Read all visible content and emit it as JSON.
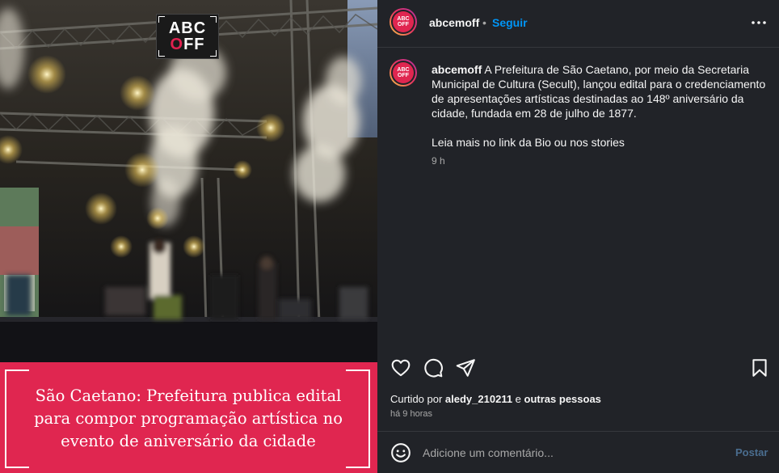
{
  "media": {
    "logo_line1": "ABC",
    "logo_line2_a": "",
    "logo_line2_o": "O",
    "logo_line2_b": "FF",
    "banner_title": "São Caetano: Prefeitura publica edital para compor programação artística no evento de aniversário da cidade",
    "accent_color": "#e02650"
  },
  "header": {
    "avatar_text": "ABC OFF",
    "username": "abcemoff",
    "separator": "•",
    "follow_label": "Seguir",
    "more_icon": "more-horizontal-icon"
  },
  "caption": {
    "username": "abcemoff",
    "text": " A Prefeitura de São Caetano, por meio da Secretaria Municipal de Cultura (Secult), lançou edital para o credenciamento de apresentações artísticas destinadas ao 148º aniversário da cidade, fundada em 28 de julho de 1877.",
    "more_text": "Leia mais no link da Bio ou nos stories",
    "time": "9 h"
  },
  "actions": {
    "like_icon": "heart-icon",
    "comment_icon": "comment-icon",
    "share_icon": "send-icon",
    "save_icon": "bookmark-icon"
  },
  "likes": {
    "prefix": "Curtido por ",
    "user": "aledy_210211",
    "middle": " e ",
    "others": "outras pessoas"
  },
  "time_ago": "há 9 horas",
  "comment": {
    "emoji_icon": "emoji-icon",
    "placeholder": "Adicione um comentário...",
    "post_label": "Postar"
  }
}
